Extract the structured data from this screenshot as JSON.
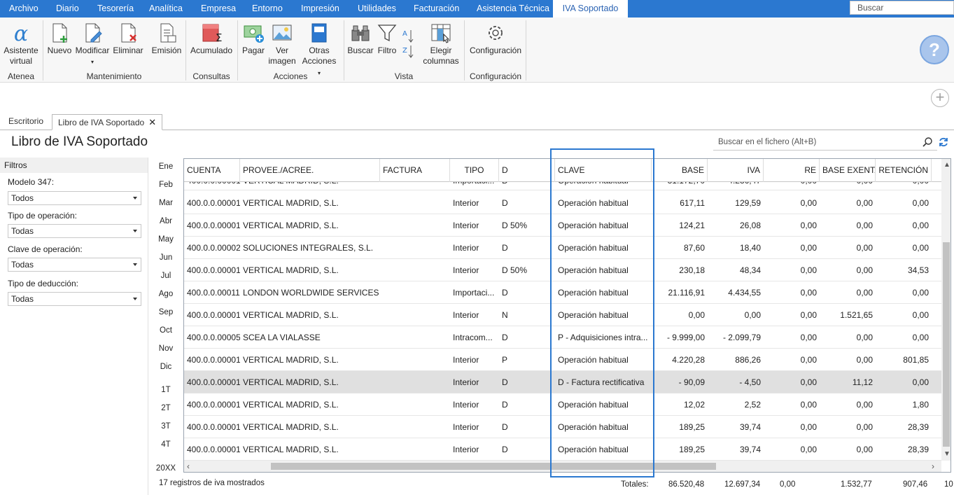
{
  "menubar": {
    "items": [
      "Archivo",
      "Diario",
      "Tesorería",
      "Analítica",
      "Empresa",
      "Entorno",
      "Impresión",
      "Utilidades",
      "Facturación",
      "Asistencia Técnica",
      "IVA Soportado"
    ],
    "search_placeholder": "Buscar"
  },
  "ribbon": {
    "asistente_l1": "Asistente",
    "asistente_l2": "virtual",
    "nuevo": "Nuevo",
    "modificar": "Modificar",
    "eliminar": "Eliminar",
    "emision": "Emisión",
    "acumulado": "Acumulado",
    "pagar": "Pagar",
    "ver_l1": "Ver",
    "ver_l2": "imagen",
    "otras_l1": "Otras",
    "otras_l2": "Acciones",
    "buscar": "Buscar",
    "filtro": "Filtro",
    "elegir_l1": "Elegir",
    "elegir_l2": "columnas",
    "configuracion": "Configuración",
    "groups": [
      "Atenea",
      "Mantenimiento",
      "Consultas",
      "Acciones",
      "Vista",
      "Configuración"
    ]
  },
  "tabs": [
    "Escritorio",
    "Libro de IVA Soportado"
  ],
  "page_title": "Libro de IVA Soportado",
  "file_search_placeholder": "Buscar en el fichero (Alt+B)",
  "filters": {
    "header": "Filtros",
    "modelo_label": "Modelo 347:",
    "modelo_value": "Todos",
    "tipo_op_label": "Tipo de operación:",
    "tipo_op_value": "Todas",
    "clave_label": "Clave de operación:",
    "clave_value": "Todas",
    "deduccion_label": "Tipo de deducción:",
    "deduccion_value": "Todas"
  },
  "months": [
    "Ene",
    "Feb",
    "Mar",
    "Abr",
    "May",
    "Jun",
    "Jul",
    "Ago",
    "Sep",
    "Oct",
    "Nov",
    "Dic",
    "1T",
    "2T",
    "3T",
    "4T",
    "20XX"
  ],
  "grid": {
    "columns": [
      "CUENTA",
      "PROVEE./ACREE.",
      "FACTURA",
      "TIPO",
      "D",
      "CLAVE",
      "BASE",
      "IVA",
      "RE",
      "BASE EXENTA",
      "RETENCIÓN"
    ],
    "partial_row": [
      "400.0.0.00001",
      "VERTICAL MADRID, S.L.",
      "",
      "Importaci...",
      "D",
      "Operación habitual",
      "31.172,70",
      "4.236,47",
      "0,00",
      "0,00",
      "0,00"
    ],
    "rows": [
      [
        "400.0.0.00001",
        "VERTICAL MADRID, S.L.",
        "",
        "Interior",
        "D",
        "Operación habitual",
        "617,11",
        "129,59",
        "0,00",
        "0,00",
        "0,00"
      ],
      [
        "400.0.0.00001",
        "VERTICAL MADRID, S.L.",
        "",
        "Interior",
        "D 50%",
        "Operación habitual",
        "124,21",
        "26,08",
        "0,00",
        "0,00",
        "0,00"
      ],
      [
        "400.0.0.00002",
        "SOLUCIONES INTEGRALES, S.L.",
        "",
        "Interior",
        "D",
        "Operación habitual",
        "87,60",
        "18,40",
        "0,00",
        "0,00",
        "0,00"
      ],
      [
        "400.0.0.00001",
        "VERTICAL MADRID, S.L.",
        "",
        "Interior",
        "D 50%",
        "Operación habitual",
        "230,18",
        "48,34",
        "0,00",
        "0,00",
        "34,53"
      ],
      [
        "400.0.0.00011",
        "LONDON WORLDWIDE SERVICES",
        "",
        "Importaci...",
        "D",
        "Operación habitual",
        "21.116,91",
        "4.434,55",
        "0,00",
        "0,00",
        "0,00"
      ],
      [
        "400.0.0.00001",
        "VERTICAL MADRID, S.L.",
        "",
        "Interior",
        "N",
        "Operación habitual",
        "0,00",
        "0,00",
        "0,00",
        "1.521,65",
        "0,00"
      ],
      [
        "400.0.0.00005",
        "SCEA LA VIALASSE",
        "",
        "Intracom...",
        "D",
        "P - Adquisiciones intra...",
        "- 9.999,00",
        "- 2.099,79",
        "0,00",
        "0,00",
        "0,00"
      ],
      [
        "400.0.0.00001",
        "VERTICAL MADRID, S.L.",
        "",
        "Interior",
        "P",
        "Operación habitual",
        "4.220,28",
        "886,26",
        "0,00",
        "0,00",
        "801,85"
      ],
      [
        "400.0.0.00001",
        "VERTICAL MADRID, S.L.",
        "",
        "Interior",
        "D",
        "D - Factura rectificativa",
        "- 90,09",
        "- 4,50",
        "0,00",
        "11,12",
        "0,00"
      ],
      [
        "400.0.0.00001",
        "VERTICAL MADRID, S.L.",
        "",
        "Interior",
        "D",
        "Operación habitual",
        "12,02",
        "2,52",
        "0,00",
        "0,00",
        "1,80"
      ],
      [
        "400.0.0.00001",
        "VERTICAL MADRID, S.L.",
        "",
        "Interior",
        "D",
        "Operación habitual",
        "189,25",
        "39,74",
        "0,00",
        "0,00",
        "28,39"
      ],
      [
        "400.0.0.00001",
        "VERTICAL MADRID, S.L.",
        "",
        "Interior",
        "D",
        "Operación habitual",
        "189,25",
        "39,74",
        "0,00",
        "0,00",
        "28,39"
      ]
    ],
    "selected_row": 8
  },
  "footer": {
    "count": "17 registros de iva mostrados",
    "totales_label": "Totales:",
    "totals": [
      "86.520,48",
      "12.697,34",
      "0,00",
      "1.532,77",
      "907,46",
      "10"
    ]
  },
  "colors": {
    "menubar": "#2b78d0",
    "highlight_border": "#2b78d0"
  }
}
